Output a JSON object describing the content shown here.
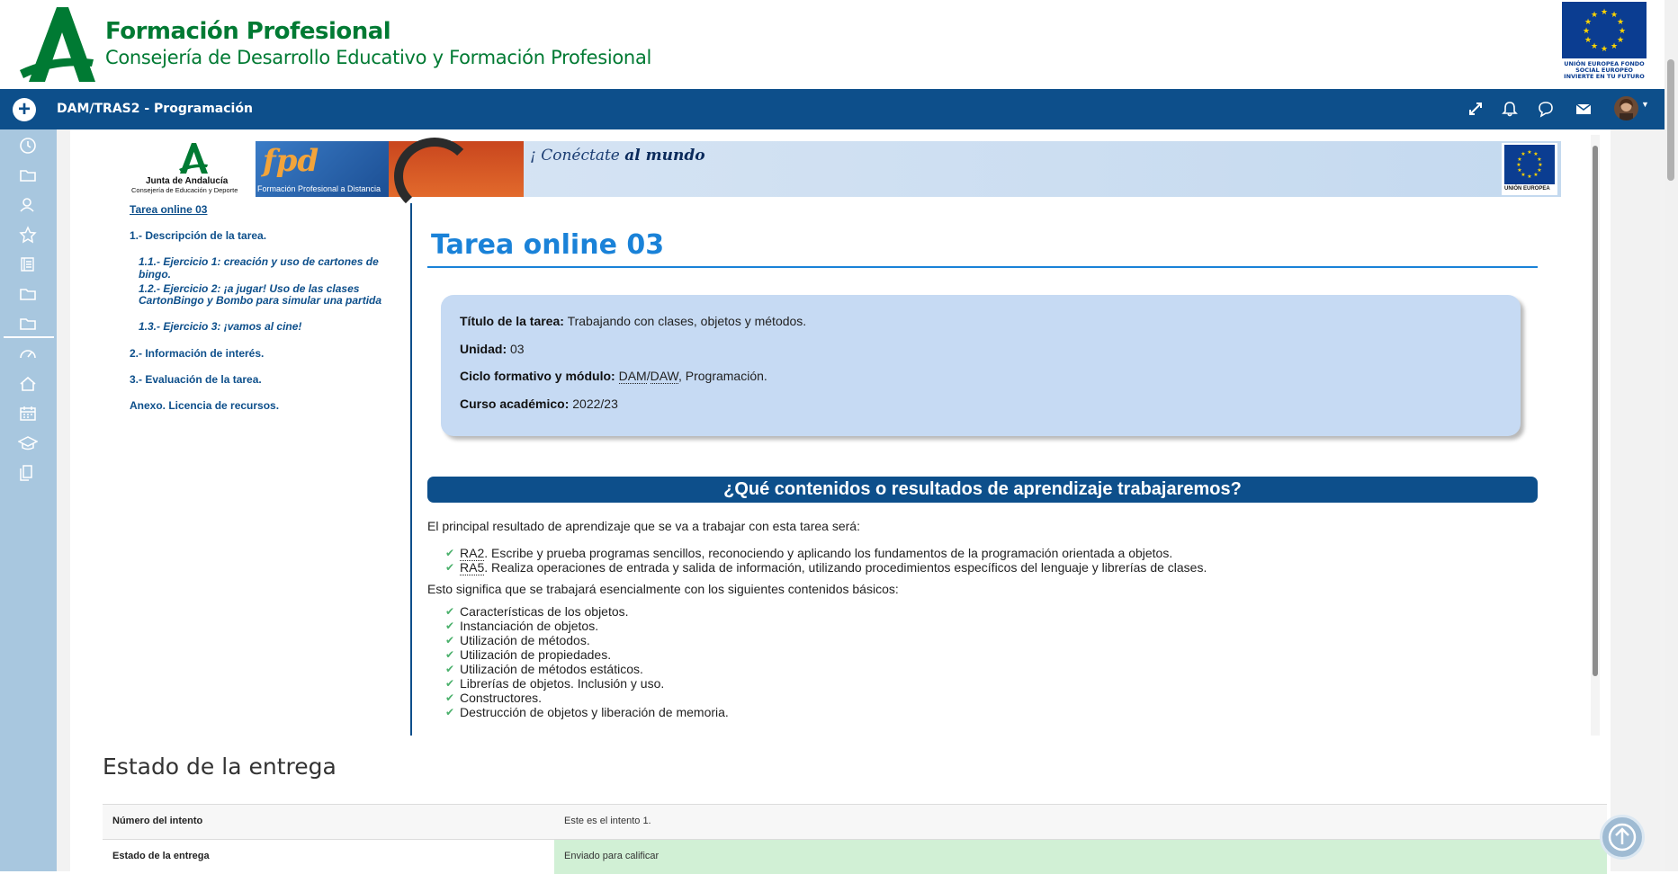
{
  "header": {
    "title": "Formación Profesional",
    "subtitle": "Consejería de Desarrollo Educativo y Formación Profesional",
    "eu_text": "UNIÓN EUROPEA FONDO SOCIAL EUROPEO INVIERTE EN TU FUTURO"
  },
  "navbar": {
    "title": "DAM/TRAS2 - Programación",
    "icons": [
      "expand-icon",
      "bell-icon",
      "chat-icon",
      "mail-icon"
    ]
  },
  "sidebar": {
    "icons": [
      "clock-icon",
      "folder-icon",
      "users-icon",
      "star-icon",
      "book-icon",
      "folder-icon",
      "folder-icon",
      "dashboard-icon",
      "home-icon",
      "calendar-icon",
      "graduation-icon",
      "files-icon"
    ]
  },
  "banner": {
    "junta_name": "Junta de Andalucía",
    "junta_sub": "Consejería de Educación y Deporte",
    "fpd_logo": "fpd",
    "fpd_text": "Formación Profesional a Distancia",
    "slogan_a": "¡ Conéctate",
    "slogan_b": "al mundo",
    "eu_label": "UNIÓN EUROPEA"
  },
  "toc": {
    "items": [
      {
        "label": "Tarea online 03"
      },
      {
        "label": "1.- Descripción de la tarea."
      },
      {
        "label": "1.1.- Ejercicio 1: creación y uso de cartones de bingo."
      },
      {
        "label": "1.2.- Ejercicio 2: ¡a jugar! Uso de las clases"
      },
      {
        "label": "CartonBingo y Bombo para simular una partida"
      },
      {
        "label": "1.3.- Ejercicio 3: ¡vamos al cine!"
      },
      {
        "label": "2.- Información de interés."
      },
      {
        "label": "3.- Evaluación de la tarea."
      },
      {
        "label": "Anexo. Licencia de recursos."
      }
    ]
  },
  "content": {
    "title": "Tarea online 03",
    "info": {
      "titulo_label": "Título de la tarea:",
      "titulo_value": "Trabajando con clases, objetos y métodos.",
      "unidad_label": "Unidad:",
      "unidad_value": "03",
      "ciclo_label": "Ciclo formativo y módulo:",
      "ciclo_dam": "DAM",
      "ciclo_sep": "/",
      "ciclo_daw": "DAW",
      "ciclo_rest": ", Programación.",
      "curso_label": "Curso académico:",
      "curso_value": "2022/23"
    },
    "section_heading": "¿Qué contenidos o resultados de aprendizaje trabajaremos?",
    "para1": "El principal resultado de aprendizaje que se va a trabajar con esta tarea será:",
    "ra": [
      {
        "code": "RA2",
        "text": ". Escribe y prueba programas sencillos, reconociendo y aplicando los fundamentos de la programación orientada a objetos."
      },
      {
        "code": "RA5",
        "text": ". Realiza operaciones de entrada y salida de información, utilizando procedimientos específicos del lenguaje y librerías de clases."
      }
    ],
    "para2": "Esto significa que se trabajará esencialmente con los siguientes contenidos básicos:",
    "contenidos": [
      "Características de los objetos.",
      "Instanciación de objetos.",
      "Utilización de métodos.",
      "Utilización de propiedades.",
      "Utilización de métodos estáticos.",
      "Librerías de objetos. Inclusión y uso.",
      "Constructores.",
      "Destrucción de objetos y liberación de memoria."
    ]
  },
  "status": {
    "title": "Estado de la entrega",
    "rows": [
      {
        "label": "Número del intento",
        "value": "Este es el intento 1."
      },
      {
        "label": "Estado de la entrega",
        "value": "Enviado para calificar"
      }
    ],
    "submitted_color": "#d1f0d5"
  },
  "colors": {
    "brand_green": "#007a33",
    "navbar": "#0d4f8b",
    "sidebar": "#a8c7df",
    "accent_blue": "#1a82d8"
  }
}
